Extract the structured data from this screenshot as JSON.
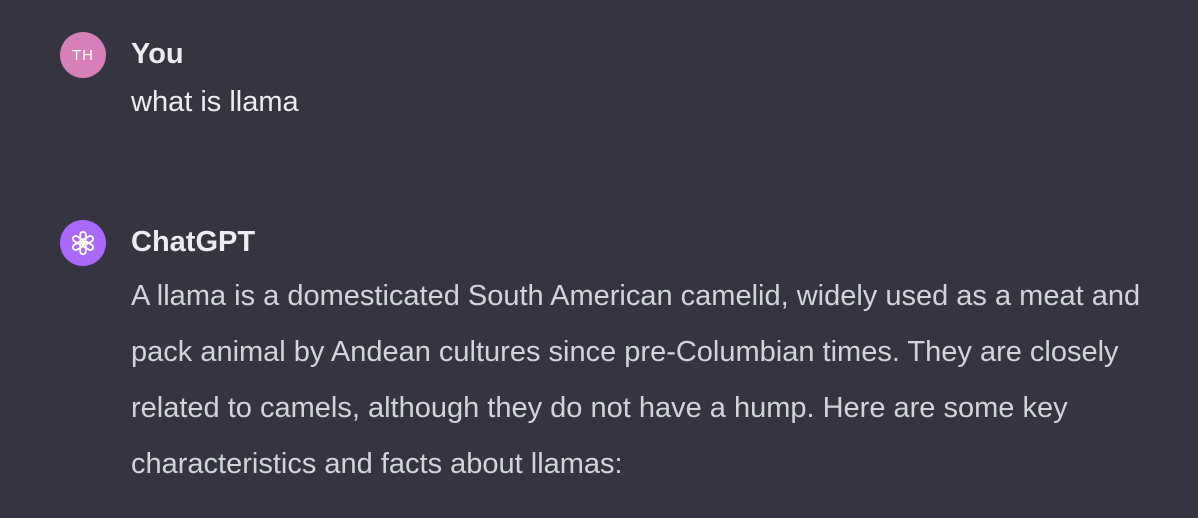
{
  "conversation": {
    "user_message": {
      "avatar_initials": "TH",
      "author": "You",
      "text": "what is llama"
    },
    "assistant_message": {
      "avatar_icon": "openai-logo-icon",
      "author": "ChatGPT",
      "text": "A llama is a domesticated South American camelid, widely used as a meat and pack animal by Andean cultures since pre-Columbian times. They are closely related to camels, although they do not have a hump. Here are some key characteristics and facts about llamas:"
    }
  },
  "colors": {
    "background": "#343541",
    "user_avatar": "#d77fb9",
    "assistant_avatar": "#ab68ff",
    "text_primary": "#ececf1",
    "text_body": "#d1d5db"
  }
}
